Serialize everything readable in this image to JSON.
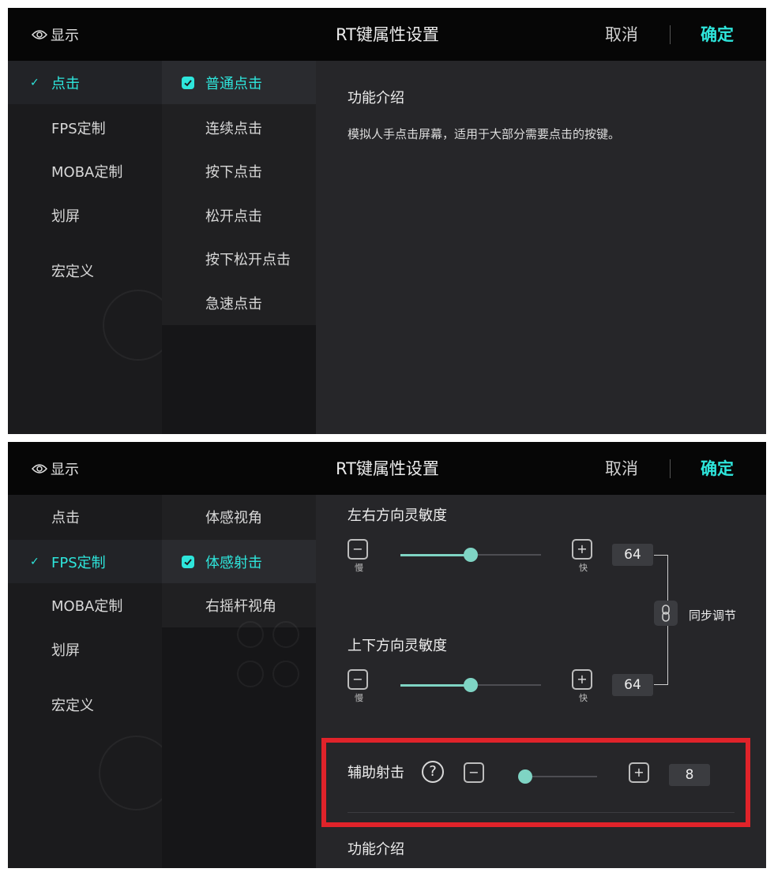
{
  "panel1": {
    "show_label": "显示",
    "title": "RT键属性设置",
    "cancel_label": "取消",
    "confirm_label": "确定",
    "nav": [
      {
        "label": "点击",
        "selected": true
      },
      {
        "label": "FPS定制",
        "selected": false
      },
      {
        "label": "MOBA定制",
        "selected": false
      },
      {
        "label": "划屏",
        "selected": false
      },
      {
        "label": "宏定义",
        "selected": false
      }
    ],
    "sub": [
      {
        "label": "普通点击",
        "selected": true
      },
      {
        "label": "连续点击",
        "selected": false
      },
      {
        "label": "按下点击",
        "selected": false
      },
      {
        "label": "松开点击",
        "selected": false
      },
      {
        "label": "按下松开点击",
        "selected": false
      },
      {
        "label": "急速点击",
        "selected": false
      }
    ],
    "feature_title": "功能介绍",
    "feature_desc": "模拟人手点击屏幕，适用于大部分需要点击的按键。"
  },
  "panel2": {
    "show_label": "显示",
    "title": "RT键属性设置",
    "cancel_label": "取消",
    "confirm_label": "确定",
    "nav": [
      {
        "label": "点击",
        "selected": false
      },
      {
        "label": "FPS定制",
        "selected": true
      },
      {
        "label": "MOBA定制",
        "selected": false
      },
      {
        "label": "划屏",
        "selected": false
      },
      {
        "label": "宏定义",
        "selected": false
      }
    ],
    "sub": [
      {
        "label": "体感视角",
        "selected": false
      },
      {
        "label": "体感射击",
        "selected": true
      },
      {
        "label": "右摇杆视角",
        "selected": false
      }
    ],
    "lr_sens": {
      "label": "左右方向灵敏度",
      "value": "64",
      "slow": "慢",
      "fast": "快",
      "level": 0.5
    },
    "ud_sens": {
      "label": "上下方向灵敏度",
      "value": "64",
      "slow": "慢",
      "fast": "快",
      "level": 0.5
    },
    "sync_label": "同步调节",
    "assist": {
      "label": "辅助射击",
      "help": "?",
      "value": "8",
      "level": 0.05
    },
    "feature_title": "功能介绍"
  },
  "symbols": {
    "minus": "−",
    "plus": "+",
    "check": "✓"
  },
  "colors": {
    "accent": "#2ee6dc",
    "slider": "#7fd4c4",
    "highlight_box": "#e0232a"
  }
}
